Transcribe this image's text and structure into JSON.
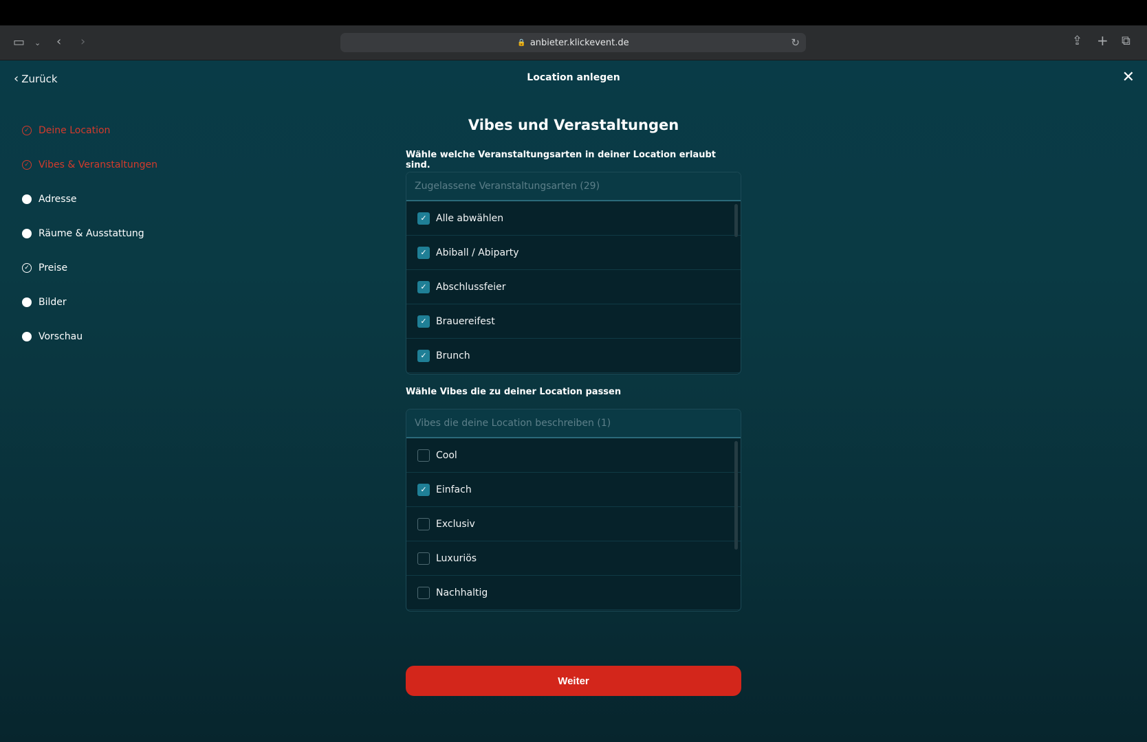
{
  "browser": {
    "url": "anbieter.klickevent.de"
  },
  "header": {
    "back_label": "Zurück",
    "title": "Location anlegen"
  },
  "steps": [
    {
      "label": "Deine Location",
      "state": "done"
    },
    {
      "label": "Vibes & Veranstaltungen",
      "state": "done"
    },
    {
      "label": "Adresse",
      "state": "todo"
    },
    {
      "label": "Räume & Ausstattung",
      "state": "todo"
    },
    {
      "label": "Preise",
      "state": "checked"
    },
    {
      "label": "Bilder",
      "state": "todo"
    },
    {
      "label": "Vorschau",
      "state": "todo"
    }
  ],
  "main": {
    "title": "Vibes und Verastaltungen",
    "events_prompt": "Wähle welche Veranstaltungsarten in deiner Location erlaubt sind.",
    "events_placeholder": "Zugelassene Veranstaltungsarten (29)",
    "events_options": [
      {
        "label": "Alle abwählen",
        "checked": true
      },
      {
        "label": "Abiball / Abiparty",
        "checked": true
      },
      {
        "label": "Abschlussfeier",
        "checked": true
      },
      {
        "label": "Brauereifest",
        "checked": true
      },
      {
        "label": "Brunch",
        "checked": true
      }
    ],
    "vibes_prompt": "Wähle Vibes die zu deiner Location passen",
    "vibes_placeholder": "Vibes die deine Location beschreiben (1)",
    "vibes_options": [
      {
        "label": "Cool",
        "checked": false
      },
      {
        "label": "Einfach",
        "checked": true
      },
      {
        "label": "Exclusiv",
        "checked": false
      },
      {
        "label": "Luxuriös",
        "checked": false
      },
      {
        "label": "Nachhaltig",
        "checked": false
      }
    ],
    "next_label": "Weiter"
  },
  "colors": {
    "accent": "#d3261b",
    "checkbox_on": "#1f7f96",
    "step_done": "#d33a2c"
  }
}
